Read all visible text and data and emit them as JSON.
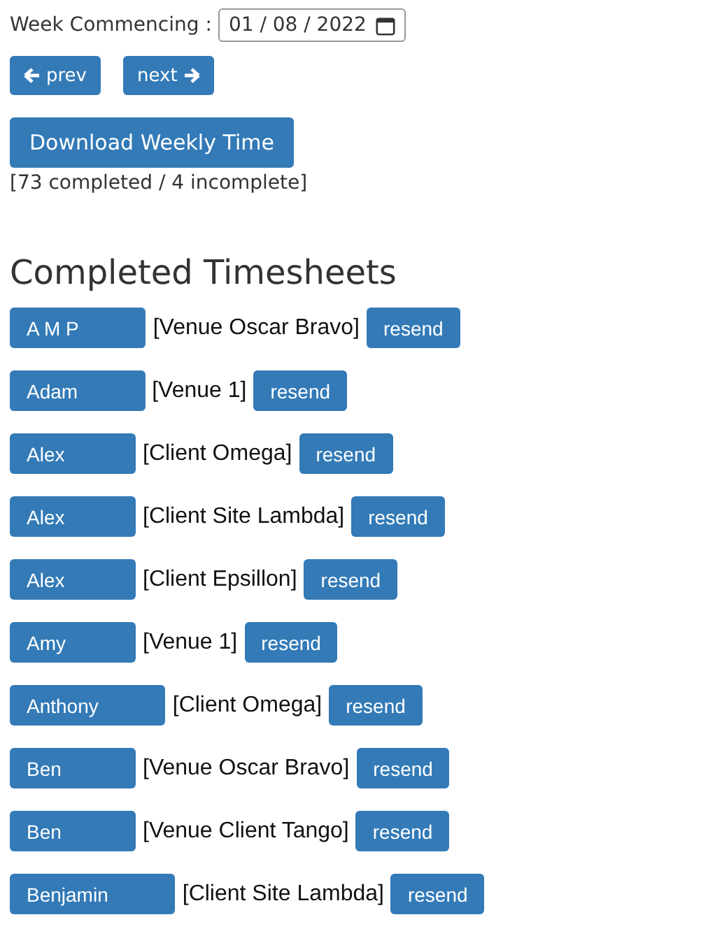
{
  "week_picker": {
    "label": "Week Commencing :",
    "value": "01 / 08 / 2022"
  },
  "nav_buttons": [
    {
      "kind": "prev",
      "label": "prev"
    },
    {
      "kind": "next",
      "label": "next"
    }
  ],
  "download_button": "Download Weekly Time",
  "summary": "[73 completed / 4 incomplete]",
  "section_title": "Completed Timesheets",
  "timesheets": [
    {
      "name": "A M P",
      "site": "[Venue Oscar Bravo]",
      "action": "resend"
    },
    {
      "name": "Adam",
      "site": "[Venue 1]",
      "action": "resend"
    },
    {
      "name": "Alex",
      "site": "[Client Omega]",
      "action": "resend"
    },
    {
      "name": "Alex",
      "site": "[Client Site Lambda]",
      "action": "resend"
    },
    {
      "name": "Alex",
      "site": "[Client Epsillon]",
      "action": "resend"
    },
    {
      "name": "Amy",
      "site": "[Venue 1]",
      "action": "resend"
    },
    {
      "name": "Anthony",
      "site": "[Client Omega]",
      "action": "resend"
    },
    {
      "name": "Ben",
      "site": "[Venue Oscar Bravo]",
      "action": "resend"
    },
    {
      "name": "Ben",
      "site": "[Venue Client Tango]",
      "action": "resend"
    },
    {
      "name": "Benjamin",
      "site": "[Client Site Lambda]",
      "action": "resend"
    }
  ]
}
